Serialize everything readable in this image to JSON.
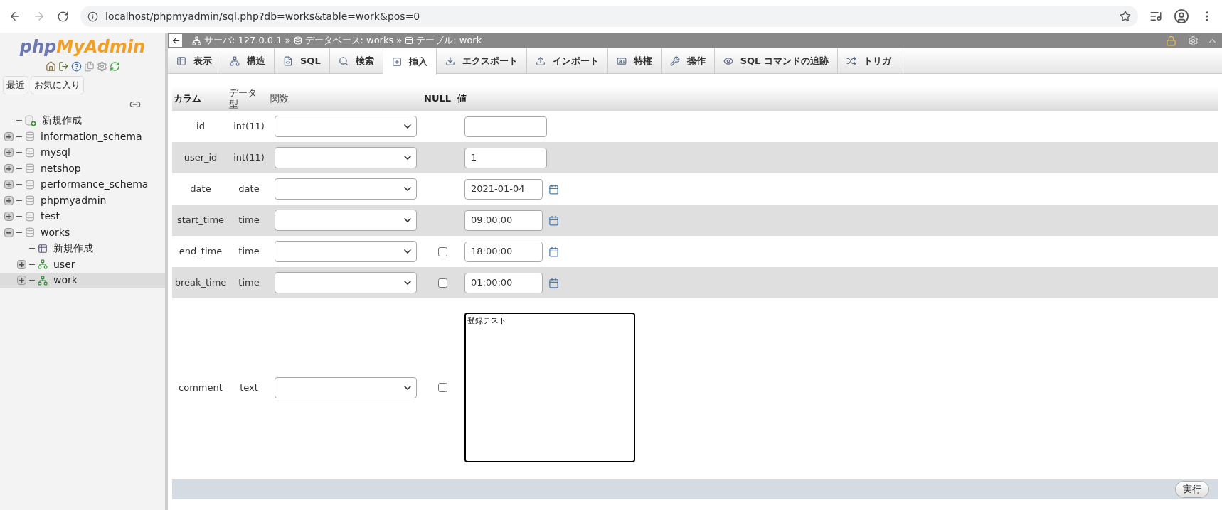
{
  "browser": {
    "url": "localhost/phpmyadmin/sql.php?db=works&table=work&pos=0"
  },
  "sidebar": {
    "logo": {
      "prefix": "php",
      "suffix": "MyAdmin"
    },
    "buttons": [
      "最近",
      "お気に入り"
    ],
    "tree": [
      {
        "kind": "new",
        "label": "新規作成",
        "selected": false
      },
      {
        "kind": "db",
        "label": "information_schema",
        "expanded": false,
        "selected": false
      },
      {
        "kind": "db",
        "label": "mysql",
        "expanded": false,
        "selected": false
      },
      {
        "kind": "db",
        "label": "netshop",
        "expanded": false,
        "selected": false
      },
      {
        "kind": "db",
        "label": "performance_schema",
        "expanded": false,
        "selected": false
      },
      {
        "kind": "db",
        "label": "phpmyadmin",
        "expanded": false,
        "selected": false
      },
      {
        "kind": "db",
        "label": "test",
        "expanded": false,
        "selected": false
      },
      {
        "kind": "db",
        "label": "works",
        "expanded": true,
        "selected": false,
        "children": [
          {
            "kind": "new_table",
            "label": "新規作成",
            "selected": false
          },
          {
            "kind": "table",
            "label": "user",
            "expanded": false,
            "selected": false
          },
          {
            "kind": "table",
            "label": "work",
            "expanded": false,
            "selected": true
          }
        ]
      }
    ]
  },
  "breadcrumb": {
    "separator": "»",
    "items": [
      {
        "kind": "server",
        "label": "サーバ: 127.0.0.1"
      },
      {
        "kind": "database",
        "label": "データベース: works"
      },
      {
        "kind": "table",
        "label": "テーブル: work"
      }
    ]
  },
  "tabs": [
    {
      "kind": "browse",
      "label": "表示",
      "selected": false
    },
    {
      "kind": "structure",
      "label": "構造",
      "selected": false
    },
    {
      "kind": "sql",
      "label": "SQL",
      "selected": false
    },
    {
      "kind": "search",
      "label": "検索",
      "selected": false
    },
    {
      "kind": "insert",
      "label": "挿入",
      "selected": true
    },
    {
      "kind": "export",
      "label": "エクスポート",
      "selected": false
    },
    {
      "kind": "import",
      "label": "インポート",
      "selected": false
    },
    {
      "kind": "privileges",
      "label": "特権",
      "selected": false
    },
    {
      "kind": "operations",
      "label": "操作",
      "selected": false
    },
    {
      "kind": "tracking",
      "label": "SQL コマンドの追跡",
      "selected": false
    },
    {
      "kind": "triggers",
      "label": "トリガ",
      "selected": false
    }
  ],
  "table": {
    "columns": [
      "カラム",
      "データ型",
      "関数",
      "NULL",
      "値"
    ],
    "rows": [
      {
        "kind": "input",
        "column": "id",
        "type": "int(11)"
      },
      {
        "kind": "input",
        "column": "user_id",
        "type": "int(11)",
        "value": "1"
      },
      {
        "kind": "date_input",
        "column": "date",
        "type": "date",
        "value": "2021-01-04"
      },
      {
        "kind": "date_input",
        "column": "start_time",
        "type": "time",
        "value": "09:00:00"
      },
      {
        "kind": "date_input",
        "column": "end_time",
        "type": "time",
        "value": "18:00:00",
        "null_checked": false
      },
      {
        "kind": "date_input",
        "column": "break_time",
        "type": "time",
        "value": "01:00:00",
        "null_checked": false
      },
      {
        "kind": "textarea",
        "column": "comment",
        "type": "text",
        "value": "登録テスト",
        "null_checked": false
      }
    ]
  },
  "submit": "実行"
}
